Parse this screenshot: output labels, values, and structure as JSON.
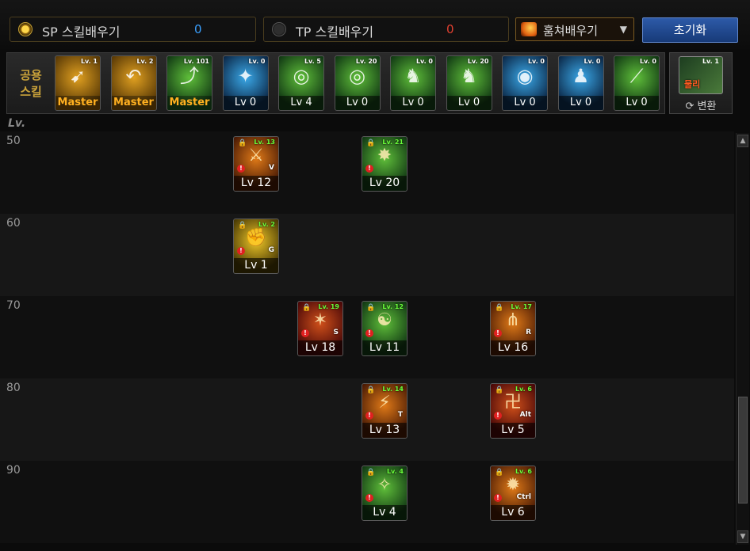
{
  "top": {
    "sp": {
      "label": "SP 스킬배우기",
      "value": "0"
    },
    "tp": {
      "label": "TP 스킬배우기",
      "value": "0"
    },
    "steal_label": "훔쳐배우기",
    "reset_label": "초기화"
  },
  "common": {
    "label": "공용\n스킬",
    "convert_label": "변환",
    "convert_tag": "Lv. 1",
    "convert_badge": "물리",
    "skills": [
      {
        "tag": "Lv. 1",
        "caption": "Master",
        "icon": "dash-icon",
        "color": "gold"
      },
      {
        "tag": "Lv. 2",
        "caption": "Master",
        "icon": "backstep-icon",
        "color": "gold"
      },
      {
        "tag": "Lv. 101",
        "caption": "Master",
        "icon": "leap-icon",
        "color": "green"
      },
      {
        "tag": "Lv. 0",
        "caption": "Lv 0",
        "icon": "wings-icon",
        "color": "blue"
      },
      {
        "tag": "Lv. 5",
        "caption": "Lv 4",
        "icon": "target-icon",
        "color": "green"
      },
      {
        "tag": "Lv. 20",
        "caption": "Lv 0",
        "icon": "target-icon",
        "color": "green"
      },
      {
        "tag": "Lv. 0",
        "caption": "Lv 0",
        "icon": "figure-icon",
        "color": "green"
      },
      {
        "tag": "Lv. 20",
        "caption": "Lv 0",
        "icon": "figure-icon",
        "color": "green"
      },
      {
        "tag": "Lv. 0",
        "caption": "Lv 0",
        "icon": "eye-icon",
        "color": "blue"
      },
      {
        "tag": "Lv. 0",
        "caption": "Lv 0",
        "icon": "body-icon",
        "color": "blue"
      },
      {
        "tag": "Lv. 0",
        "caption": "Lv 0",
        "icon": "swipe-icon",
        "color": "green"
      }
    ]
  },
  "tree": {
    "header": "Lv.",
    "levels": [
      "50",
      "60",
      "70",
      "80",
      "90"
    ],
    "skills": [
      {
        "row": 0,
        "col": 0,
        "tag": "Lv. 13",
        "hotkey": "V",
        "caption": "Lv 12",
        "icon": "slash-icon",
        "color": "orange"
      },
      {
        "row": 0,
        "col": 2,
        "tag": "Lv. 21",
        "hotkey": "",
        "caption": "Lv 20",
        "icon": "burst-icon",
        "color": "green"
      },
      {
        "row": 1,
        "col": 0,
        "tag": "Lv. 2",
        "hotkey": "G",
        "caption": "Lv 1",
        "icon": "fist-icon",
        "color": "yellow"
      },
      {
        "row": 2,
        "col": 1,
        "tag": "Lv. 19",
        "hotkey": "S",
        "caption": "Lv 18",
        "icon": "star-icon",
        "color": "red"
      },
      {
        "row": 2,
        "col": 2,
        "tag": "Lv. 12",
        "hotkey": "",
        "caption": "Lv 11",
        "icon": "monk-icon",
        "color": "green"
      },
      {
        "row": 2,
        "col": 4,
        "tag": "Lv. 17",
        "hotkey": "R",
        "caption": "Lv 16",
        "icon": "claw-icon",
        "color": "orange"
      },
      {
        "row": 3,
        "col": 2,
        "tag": "Lv. 14",
        "hotkey": "T",
        "caption": "Lv 13",
        "icon": "strike-icon",
        "color": "orange"
      },
      {
        "row": 3,
        "col": 4,
        "tag": "Lv. 6",
        "hotkey": "Alt",
        "caption": "Lv 5",
        "icon": "scroll-icon",
        "color": "red"
      },
      {
        "row": 4,
        "col": 2,
        "tag": "Lv. 4",
        "hotkey": "",
        "caption": "Lv 4",
        "icon": "aura-icon",
        "color": "green"
      },
      {
        "row": 4,
        "col": 4,
        "tag": "Lv. 6",
        "hotkey": "Ctrl",
        "caption": "Lv 6",
        "icon": "flame-icon",
        "color": "orange"
      }
    ]
  },
  "palette": {
    "gold": [
      "#5a3a06",
      "#e0a020"
    ],
    "green": [
      "#123a14",
      "#5fbf3a"
    ],
    "blue": [
      "#0c2a4a",
      "#3aa8e8"
    ],
    "orange": [
      "#4a1a04",
      "#e07a18"
    ],
    "yellow": [
      "#4a3a04",
      "#f0c828"
    ],
    "red": [
      "#4a0808",
      "#d0501a"
    ]
  }
}
